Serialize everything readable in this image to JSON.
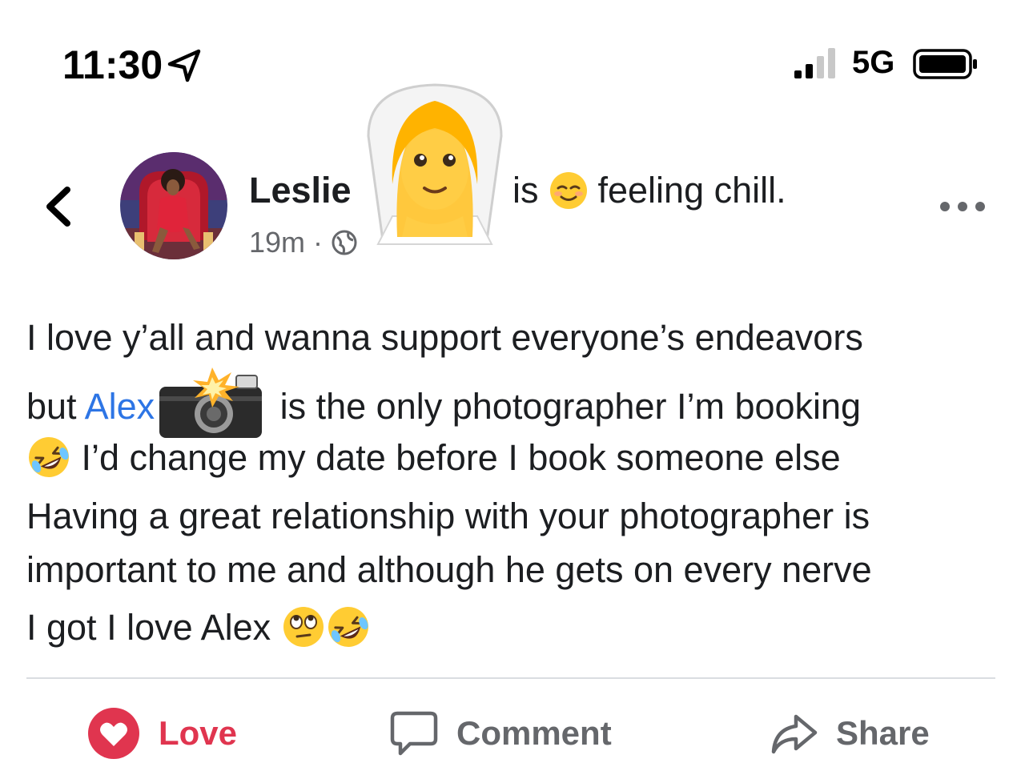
{
  "status_bar": {
    "time": "11:30",
    "network": "5G"
  },
  "post": {
    "author": "Leslie",
    "timestamp": "19m",
    "meta_separator": "·",
    "feeling_prefix": "is",
    "feeling_text": "feeling chill.",
    "body": {
      "line1": "I love y’all and wanna support everyone’s endeavors",
      "line2_start": "but ",
      "mention": "Alex",
      "line2_end": " is the only photographer I’m booking",
      "line3": " I’d change my date before I book someone else",
      "line4": "Having a great relationship with your photographer is",
      "line5": "important to me and although he gets on every nerve",
      "line6": "I got I love Alex "
    }
  },
  "actions": {
    "love": "Love",
    "comment": "Comment",
    "share": "Share"
  },
  "colors": {
    "love_active": "#e0354f",
    "mention_link": "#2d75e5",
    "secondary_text": "#65676b",
    "divider": "#dadde1"
  },
  "icons": [
    "location-arrow-icon",
    "signal-icon",
    "battery-icon",
    "back-chevron-icon",
    "globe-icon",
    "bride-with-veil-emoji",
    "relieved-face-emoji",
    "more-icon",
    "camera-with-flash-emoji",
    "rolling-on-floor-laughing-emoji",
    "face-with-rolling-eyes-emoji",
    "heart-icon",
    "comment-icon",
    "share-icon"
  ]
}
